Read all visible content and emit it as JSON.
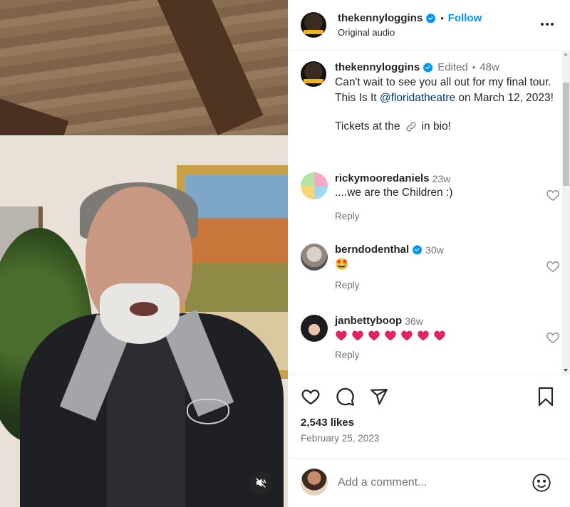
{
  "post": {
    "author": "thekennyloggins",
    "follow_label": "Follow",
    "separator": "•",
    "audio": "Original audio",
    "more_label": "More options"
  },
  "caption": {
    "username": "thekennyloggins",
    "edited": "Edited",
    "separator": "•",
    "time": "48w",
    "text_before": "Can't wait to see you all out for my final tour. This Is It ",
    "mention": "@floridatheatre",
    "text_after": " on March 12, 2023!",
    "tickets_before": "Tickets at the",
    "tickets_after": "in bio!"
  },
  "comments": [
    {
      "username": "rickymooredaniels",
      "time": "23w",
      "text": "....we are the Children :)",
      "verified": false,
      "reply": "Reply"
    },
    {
      "username": "berndodenthal",
      "time": "30w",
      "text": "🤩",
      "verified": true,
      "reply": "Reply"
    },
    {
      "username": "janbettyboop",
      "time": "36w",
      "text": "❤️❤️❤️❤️❤️❤️❤️",
      "heart_count": 7,
      "verified": false,
      "reply": "Reply"
    }
  ],
  "engagement": {
    "likes": "2,543 likes",
    "date": "February 25, 2023"
  },
  "composer": {
    "placeholder": "Add a comment..."
  },
  "colors": {
    "accent": "#0095f6",
    "verified": "#0095f6",
    "mention": "#00376b",
    "muted": "#737373",
    "heart_emoji": "#e0245e"
  },
  "icons": {
    "like": "heart-icon",
    "comment": "comment-icon",
    "share": "send-icon",
    "save": "bookmark-icon",
    "mute": "muted-speaker-icon",
    "emoji": "smiley-icon",
    "link": "link-icon",
    "more": "ellipsis-icon"
  }
}
